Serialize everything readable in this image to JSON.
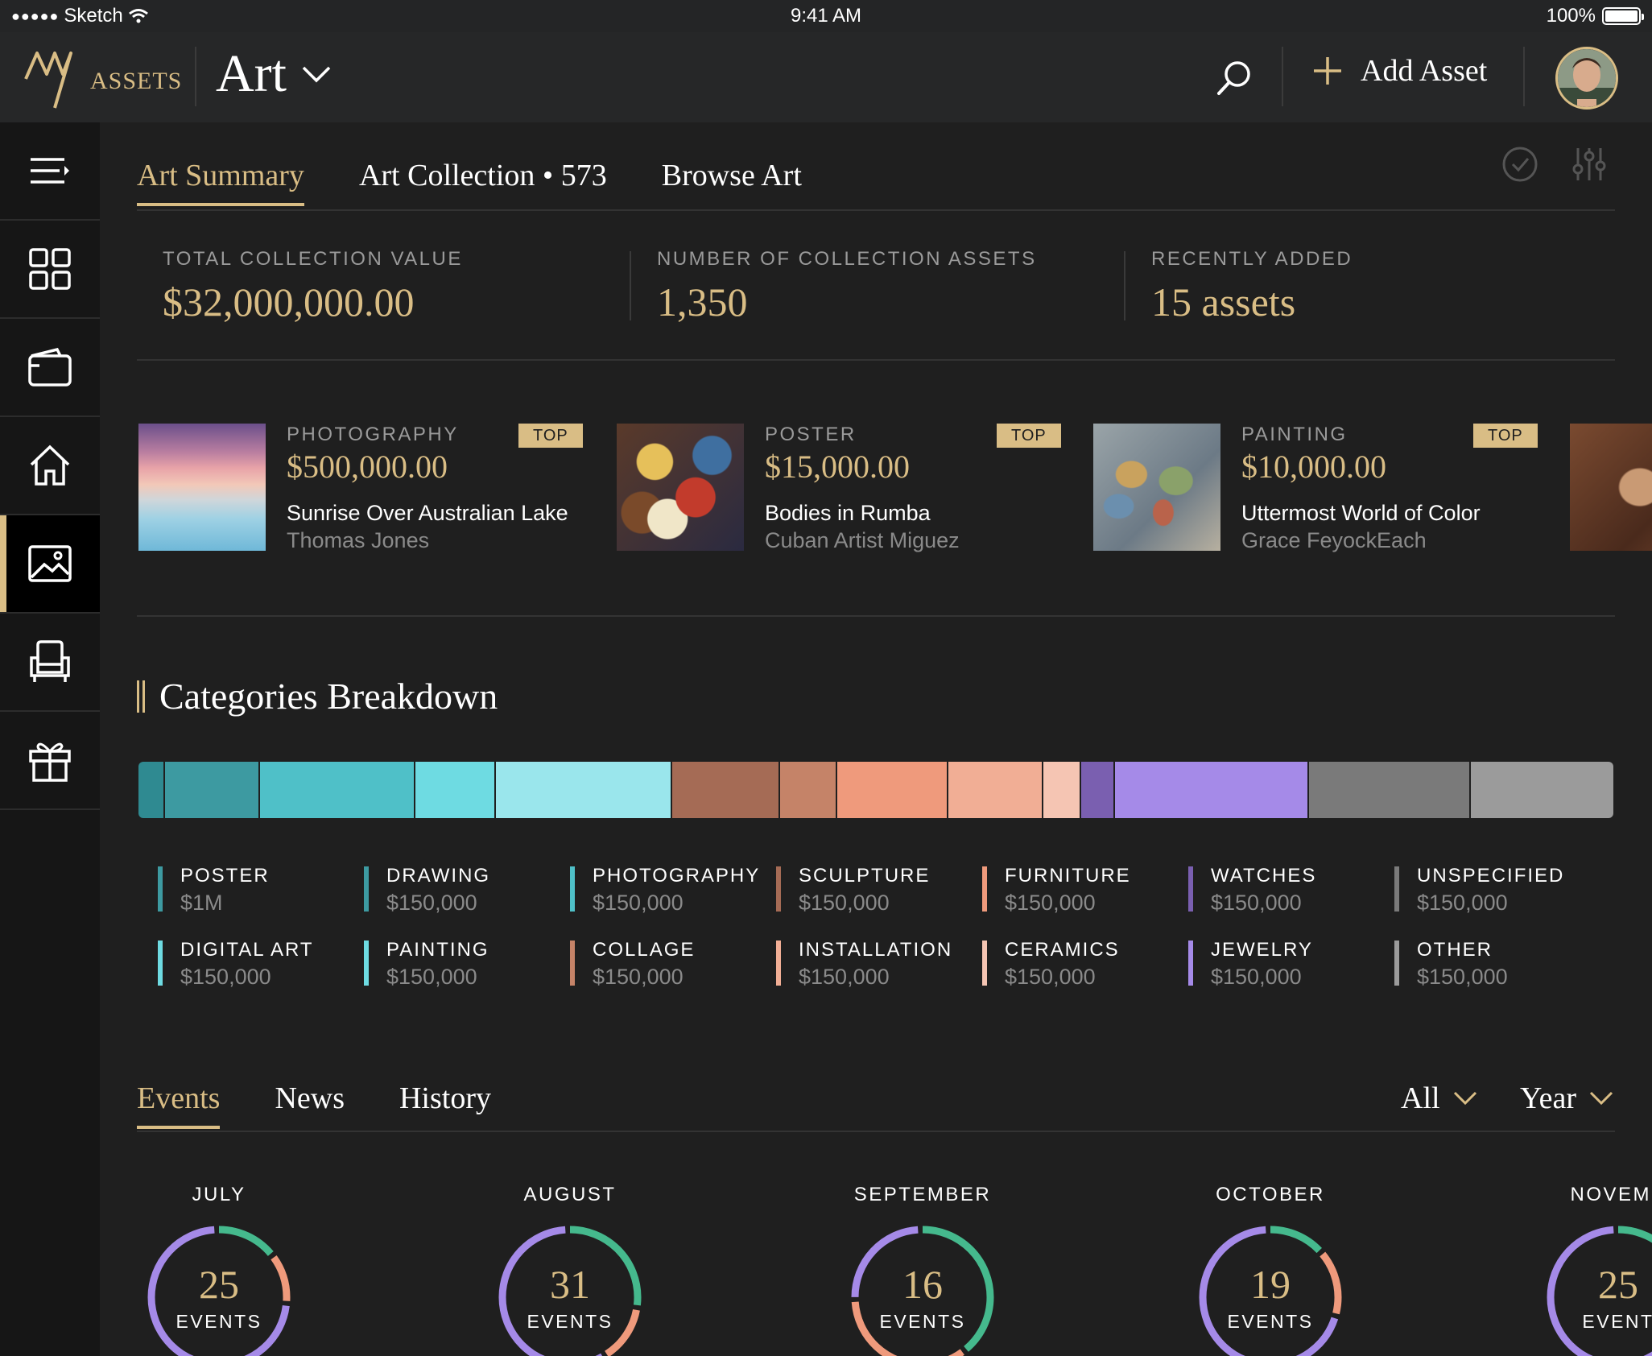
{
  "status_bar": {
    "carrier": "Sketch",
    "time": "9:41 AM",
    "battery": "100%"
  },
  "header": {
    "logo_text": "ASSETS",
    "logo_mark": "MY",
    "section": "Art",
    "add_asset_label": "Add Asset"
  },
  "sidebar": {
    "items": [
      {
        "name": "menu",
        "icon": "menu-icon"
      },
      {
        "name": "dashboard",
        "icon": "grid-icon"
      },
      {
        "name": "wallet",
        "icon": "wallet-icon"
      },
      {
        "name": "real-estate",
        "icon": "home-icon"
      },
      {
        "name": "art",
        "icon": "image-icon",
        "active": true
      },
      {
        "name": "furniture",
        "icon": "armchair-icon"
      },
      {
        "name": "gifts",
        "icon": "gift-icon"
      }
    ]
  },
  "tabs": [
    {
      "label": "Art Summary",
      "active": true
    },
    {
      "label": "Art Collection • 573",
      "active": false
    },
    {
      "label": "Browse Art",
      "active": false
    }
  ],
  "stats": [
    {
      "label": "TOTAL COLLECTION VALUE",
      "value": "$32,000,000.00",
      "accent": true
    },
    {
      "label": "NUMBER OF COLLECTION ASSETS",
      "value": "1,350",
      "accent": true
    },
    {
      "label": "RECENTLY ADDED",
      "value": "15 assets",
      "accent": true
    }
  ],
  "featured": [
    {
      "category": "PHOTOGRAPHY",
      "badge": "TOP",
      "price": "$500,000.00",
      "title": "Sunrise Over Australian Lake",
      "artist": "Thomas Jones"
    },
    {
      "category": "POSTER",
      "badge": "TOP",
      "price": "$15,000.00",
      "title": "Bodies in Rumba",
      "artist": "Cuban Artist Miguez"
    },
    {
      "category": "PAINTING",
      "badge": "TOP",
      "price": "$10,000.00",
      "title": "Uttermost World of Color",
      "artist": "Grace FeyockEach"
    }
  ],
  "breakdown": {
    "title": "Categories Breakdown",
    "segments": [
      {
        "share": 1.7,
        "color": "#2f8a91"
      },
      {
        "share": 6.4,
        "color": "#3d9aa1"
      },
      {
        "share": 10.6,
        "color": "#4fc0c8"
      },
      {
        "share": 5.4,
        "color": "#6edbe2"
      },
      {
        "share": 12.0,
        "color": "#9ae6ec"
      },
      {
        "share": 7.3,
        "color": "#a56b55"
      },
      {
        "share": 3.8,
        "color": "#c58368"
      },
      {
        "share": 7.5,
        "color": "#ef9a7c"
      },
      {
        "share": 6.4,
        "color": "#f1ae95"
      },
      {
        "share": 2.5,
        "color": "#f5c5b3"
      },
      {
        "share": 2.2,
        "color": "#7a5fb0"
      },
      {
        "share": 13.2,
        "color": "#a58ae8"
      },
      {
        "share": 11.0,
        "color": "#7a7a7a"
      },
      {
        "share": 9.8,
        "color": "#9b9b9b"
      }
    ],
    "legend": [
      {
        "name": "POSTER",
        "value": "$1M",
        "color": "#3d9aa1"
      },
      {
        "name": "DRAWING",
        "value": "$150,000",
        "color": "#3d9aa1"
      },
      {
        "name": "PHOTOGRAPHY",
        "value": "$150,000",
        "color": "#4fc0c8"
      },
      {
        "name": "SCULPTURE",
        "value": "$150,000",
        "color": "#a56b55"
      },
      {
        "name": "FURNITURE",
        "value": "$150,000",
        "color": "#ef9a7c"
      },
      {
        "name": "WATCHES",
        "value": "$150,000",
        "color": "#7a5fb0"
      },
      {
        "name": "UNSPECIFIED",
        "value": "$150,000",
        "color": "#7a7a7a"
      },
      {
        "name": "DIGITAL ART",
        "value": "$150,000",
        "color": "#6edbe2"
      },
      {
        "name": "PAINTING",
        "value": "$150,000",
        "color": "#6edbe2"
      },
      {
        "name": "COLLAGE",
        "value": "$150,000",
        "color": "#c58368"
      },
      {
        "name": "INSTALLATION",
        "value": "$150,000",
        "color": "#f1ae95"
      },
      {
        "name": "CERAMICS",
        "value": "$150,000",
        "color": "#f5c5b3"
      },
      {
        "name": "JEWELRY",
        "value": "$150,000",
        "color": "#a58ae8"
      },
      {
        "name": "OTHER",
        "value": "$150,000",
        "color": "#9b9b9b"
      }
    ]
  },
  "events_tabs": [
    {
      "label": "Events",
      "active": true
    },
    {
      "label": "News",
      "active": false
    },
    {
      "label": "History",
      "active": false
    }
  ],
  "filters": {
    "type": "All",
    "period": "Year"
  },
  "months": [
    {
      "name": "JULY",
      "count": "25",
      "unit": "EVENTS",
      "arcs": [
        0.15,
        0.12,
        0.73
      ]
    },
    {
      "name": "AUGUST",
      "count": "31",
      "unit": "EVENTS",
      "arcs": [
        0.28,
        0.14,
        0.58
      ]
    },
    {
      "name": "SEPTEMBER",
      "count": "16",
      "unit": "EVENTS",
      "arcs": [
        0.4,
        0.35,
        0.25
      ]
    },
    {
      "name": "OCTOBER",
      "count": "19",
      "unit": "EVENTS",
      "arcs": [
        0.14,
        0.16,
        0.7
      ]
    },
    {
      "name": "NOVEME",
      "count": "25",
      "unit": "EVENT",
      "arcs": [
        0.15,
        0.12,
        0.73
      ]
    }
  ],
  "colors": {
    "accent": "#d9bd85",
    "ring_green": "#45b98d",
    "ring_orange": "#ef9a7c",
    "ring_purple": "#a58ae8"
  }
}
